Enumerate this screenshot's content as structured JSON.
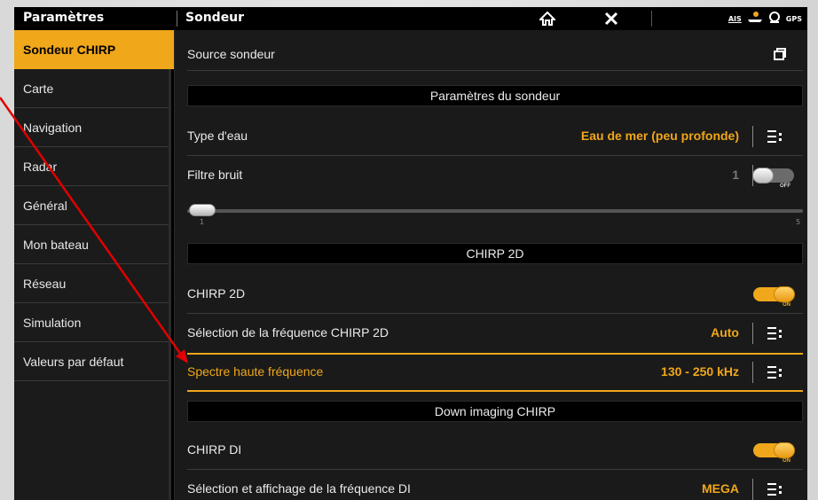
{
  "topbar": {
    "left_title": "Paramètres",
    "right_title": "Sondeur",
    "status_icons": [
      "home-icon",
      "close-icon",
      "ais-icon",
      "boat-icon",
      "sonar-icon",
      "gps-icon"
    ],
    "ais_label": "AIS",
    "gps_label": "GPS"
  },
  "sidebar": {
    "items": [
      {
        "label": "Sondeur CHIRP"
      },
      {
        "label": "Carte"
      },
      {
        "label": "Navigation"
      },
      {
        "label": "Radar"
      },
      {
        "label": "Général"
      },
      {
        "label": "Mon bateau"
      },
      {
        "label": "Réseau"
      },
      {
        "label": "Simulation"
      },
      {
        "label": "Valeurs par défaut"
      }
    ]
  },
  "main": {
    "source_row": {
      "label": "Source sondeur"
    },
    "sections": {
      "sonar_params": "Paramètres du sondeur",
      "chirp2d": "CHIRP 2D",
      "down_imaging": "Down imaging CHIRP"
    },
    "water_type": {
      "label": "Type d'eau",
      "value": "Eau de mer (peu profonde)"
    },
    "noise_filter": {
      "label": "Filtre bruit",
      "value": "1",
      "toggle": "OFF",
      "slider_min": "1",
      "slider_max": "5",
      "slider_fraction": 0
    },
    "chirp2d_toggle": {
      "label": "CHIRP 2D",
      "toggle": "ON"
    },
    "chirp2d_freq": {
      "label": "Sélection de la fréquence CHIRP 2D",
      "value": "Auto"
    },
    "spectrum": {
      "label": "Spectre haute fréquence",
      "value": "130 - 250 kHz"
    },
    "chirp_di": {
      "label": "CHIRP DI",
      "toggle": "ON"
    },
    "di_freq": {
      "label": "Sélection et affichage de la fréquence DI",
      "value": "MEGA"
    }
  },
  "colors": {
    "accent": "#f0a71a",
    "annotation": "#e00000"
  }
}
